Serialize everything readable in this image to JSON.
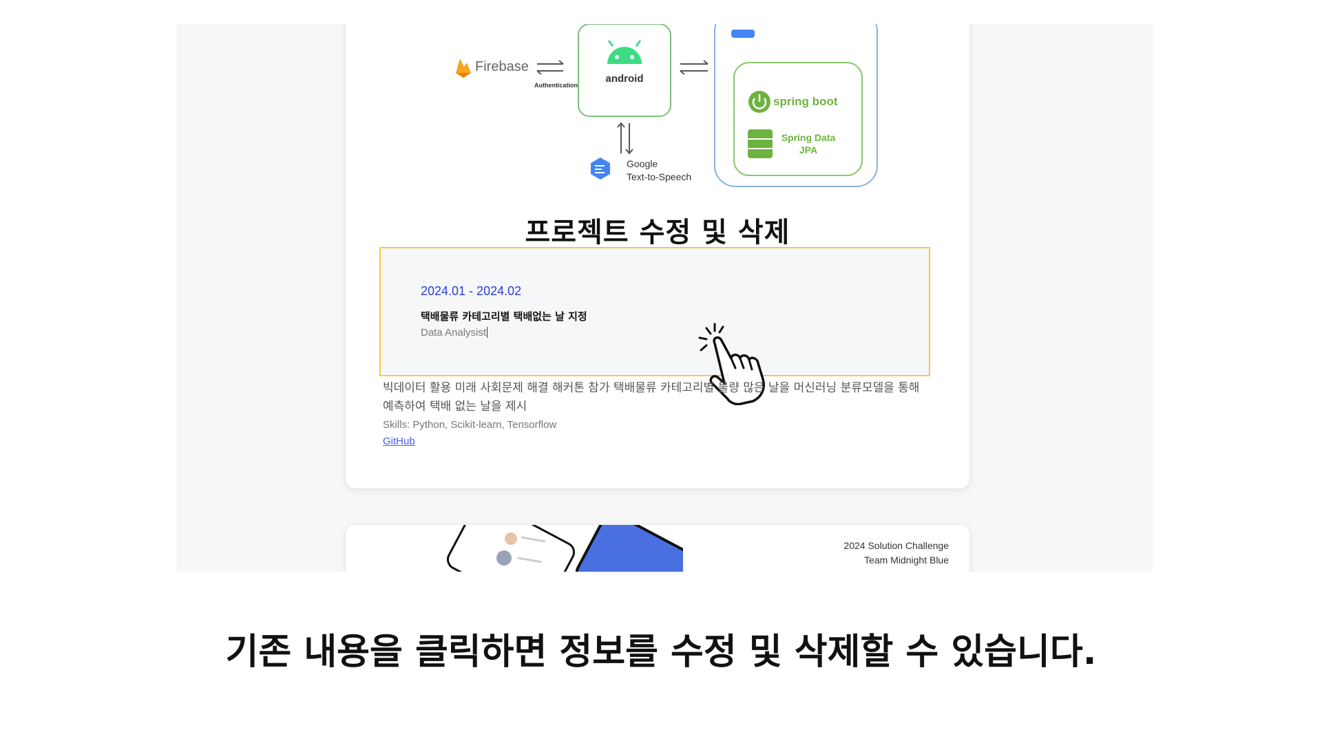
{
  "diagram": {
    "firebase": "Firebase",
    "auth": "Authentication",
    "android": "android",
    "tts_line1": "Google",
    "tts_line2": "Text-to-Speech",
    "spring_boot": "spring boot",
    "spring_data_line1": "Spring Data",
    "spring_data_line2": "JPA"
  },
  "section": {
    "title": "프로젝트 수정 및 삭제"
  },
  "edit_entry": {
    "period": "2024.01 - 2024.02",
    "title": "택배물류 카테고리별 택배없는 날 지정",
    "role": "Data Analysist"
  },
  "project": {
    "description": "빅데이터 활용 미래 사회문제 해결 해커톤 참가 택배물류 카테고리별 물량 많은 날을 머신러닝 분류모델을 통해 예측하여 택배 없는 날을 제시",
    "skills": "Skills: Python, Scikit-learn, Tensorflow",
    "link": "GitHub"
  },
  "next_card": {
    "line1": "2024 Solution Challenge",
    "line2": "Team Midnight Blue"
  },
  "caption": "기존 내용을 클릭하면 정보를 수정 및 삭제할 수 있습니다.",
  "colors": {
    "highlight_border": "#f5c84c",
    "period": "#2b3bd6",
    "link": "#4a5de8",
    "spring_green": "#6db33f",
    "gcp_blue": "#4285f4",
    "android_green": "#3ddc84"
  },
  "icons": [
    "firebase-icon",
    "android-icon",
    "text-to-speech-icon",
    "spring-boot-icon",
    "database-icon",
    "pointer-hand-icon"
  ]
}
